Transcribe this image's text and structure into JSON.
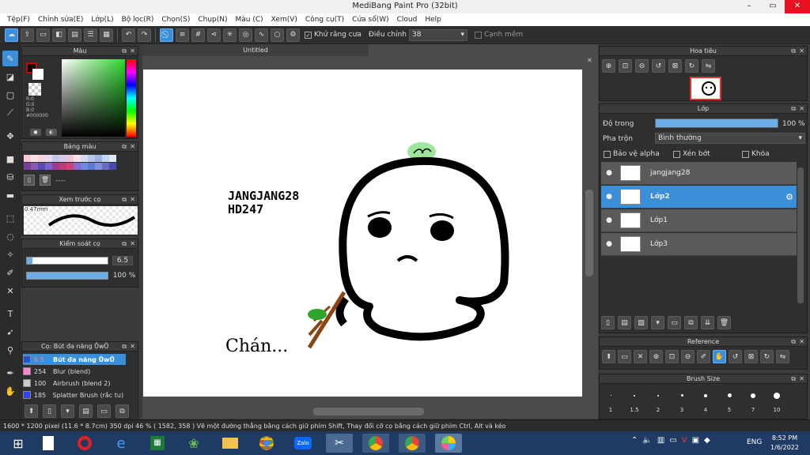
{
  "window": {
    "title": "MediBang Paint Pro (32bit)",
    "minimize": "–",
    "maximize": "▭",
    "close": "✕"
  },
  "menu": [
    "Tệp(F)",
    "Chỉnh sửa(E)",
    "Lớp(L)",
    "Bộ lọc(R)",
    "Chọn(S)",
    "Chụp(N)",
    "Màu (C)",
    "Xem(V)",
    "Công cụ(T)",
    "Cửa sổ(W)",
    "Cloud",
    "Help"
  ],
  "toolbar": {
    "antialias_label": "Khử răng cưa",
    "adjust_label": "Điều chỉnh",
    "adjust_value": "38",
    "snap_label": "Cạnh mềm"
  },
  "color_panel": {
    "title": "Màu",
    "r": "R:0",
    "g": "G:0",
    "b": "B:0",
    "hex": "#000000"
  },
  "palette_panel": {
    "title": "Bảng màu",
    "dash": "----"
  },
  "preview_panel": {
    "title": "Xem trước cọ",
    "size": "0.47mm"
  },
  "brush_control": {
    "title": "Kiểm soát cọ",
    "size_value": "6.5",
    "opacity_value": "100 %",
    "size_fraction": 0.065,
    "opacity_fraction": 1.0
  },
  "brush_list": {
    "title": "Cọ: Bút đa năng ŮwŮ",
    "items": [
      {
        "size": "6.5",
        "name": "Bút đa năng ŮwŮ",
        "color": "#2255cc"
      },
      {
        "size": "254",
        "name": "Blur (blend)",
        "color": "#ff88cc"
      },
      {
        "size": "100",
        "name": "Airbrush (blend 2)",
        "color": "#cccccc"
      },
      {
        "size": "185",
        "name": "Splatter Brush (rắc tu)",
        "color": "#3344ee"
      }
    ]
  },
  "canvas": {
    "tab": "Untitled",
    "text1": "JANGJANG28",
    "text2": "HD247",
    "text3": "Chán..."
  },
  "navigator": {
    "title": "Hoa tiêu"
  },
  "layer_panel": {
    "title": "Lớp",
    "opacity_label": "Độ trong",
    "opacity_value": "100 %",
    "opacity_fraction": 1.0,
    "blend_label": "Pha trộn",
    "blend_value": "Bình thường",
    "protect_alpha": "Bảo vệ alpha",
    "clipping": "Xén bớt",
    "lock": "Khóa",
    "layers": [
      {
        "name": "jangjang28",
        "selected": false
      },
      {
        "name": "Lớp2",
        "selected": true
      },
      {
        "name": "Lớp1",
        "selected": false
      },
      {
        "name": "Lớp3",
        "selected": false
      }
    ]
  },
  "reference": {
    "title": "Reference"
  },
  "brush_size": {
    "title": "Brush Size",
    "sizes": [
      "1",
      "1.5",
      "2",
      "3",
      "4",
      "5",
      "7",
      "10"
    ]
  },
  "status": "1600 * 1200 pixel   (11.6 * 8.7cm)   350 dpi   46 %   ( 1582, 358 )   Vẽ một đường thẳng bằng cách giữ phím Shift, Thay đổi cỡ cọ bằng cách giữ phím Ctrl, Alt và kéo",
  "taskbar": {
    "lang": "ENG",
    "time": "8:52 PM",
    "date": "1/6/2022"
  },
  "colors": {
    "accent": "#3b8fd8",
    "dark": "#2f2f2f"
  }
}
